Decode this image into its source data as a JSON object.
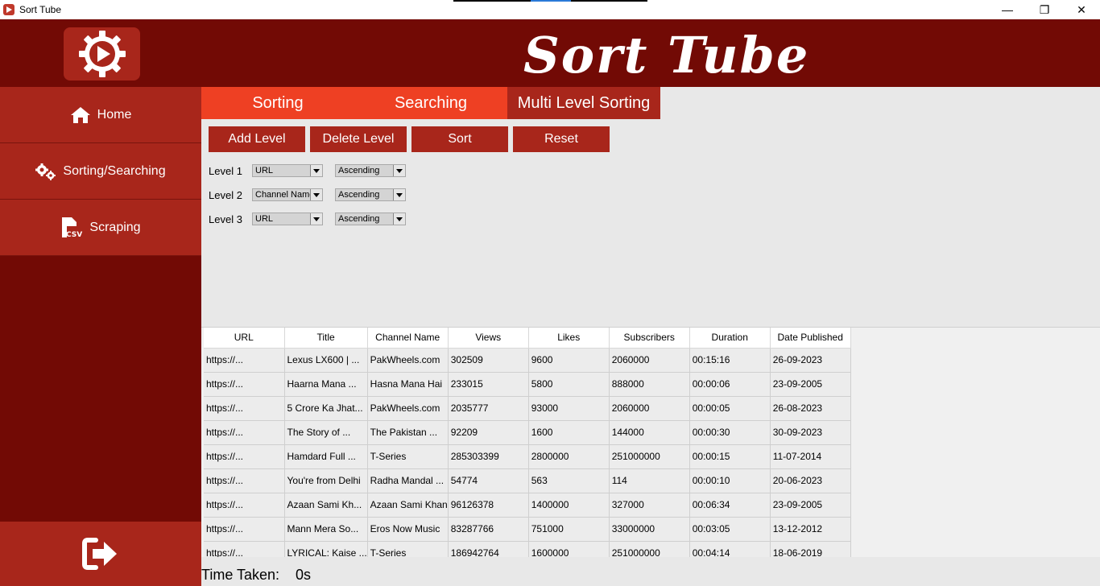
{
  "window": {
    "title": "Sort Tube",
    "min": "—",
    "max": "❐",
    "close": "✕"
  },
  "header": {
    "app_title": "Sort Tube"
  },
  "sidebar": {
    "items": [
      {
        "label": "Home",
        "icon": "home-icon"
      },
      {
        "label": "Sorting/Searching",
        "icon": "gears-icon"
      },
      {
        "label": "Scraping",
        "icon": "csv-file-icon"
      }
    ],
    "exit_icon": "logout-icon"
  },
  "tabs": [
    {
      "label": "Sorting"
    },
    {
      "label": "Searching"
    },
    {
      "label": "Multi Level Sorting",
      "active": true
    }
  ],
  "buttons": {
    "add_level": "Add Level",
    "delete_level": "Delete Level",
    "sort": "Sort",
    "reset": "Reset"
  },
  "levels": [
    {
      "label": "Level 1",
      "field": "URL",
      "order": "Ascending"
    },
    {
      "label": "Level 2",
      "field": "Channel Name",
      "order": "Ascending"
    },
    {
      "label": "Level 3",
      "field": "URL",
      "order": "Ascending"
    }
  ],
  "table": {
    "columns": [
      "URL",
      "Title",
      "Channel Name",
      "Views",
      "Likes",
      "Subscribers",
      "Duration",
      "Date Published"
    ],
    "rows": [
      [
        "https://...",
        "Lexus LX600 | ...",
        "PakWheels.com",
        "302509",
        "9600",
        "2060000",
        "00:15:16",
        "26-09-2023"
      ],
      [
        "https://...",
        "Haarna Mana ...",
        "Hasna Mana Hai",
        "233015",
        "5800",
        "888000",
        "00:00:06",
        "23-09-2005"
      ],
      [
        "https://...",
        "5 Crore Ka Jhat...",
        "PakWheels.com",
        "2035777",
        "93000",
        "2060000",
        "00:00:05",
        "26-08-2023"
      ],
      [
        "https://...",
        "The Story of ...",
        "The Pakistan ...",
        "92209",
        "1600",
        "144000",
        "00:00:30",
        "30-09-2023"
      ],
      [
        "https://...",
        "Hamdard Full ...",
        "T-Series",
        "285303399",
        "2800000",
        "251000000",
        "00:00:15",
        "11-07-2014"
      ],
      [
        "https://...",
        "You're from Delhi",
        "Radha Mandal ...",
        "54774",
        "563",
        "114",
        "00:00:10",
        "20-06-2023"
      ],
      [
        "https://...",
        "Azaan Sami Kh...",
        "Azaan Sami Khan",
        "96126378",
        "1400000",
        "327000",
        "00:06:34",
        "23-09-2005"
      ],
      [
        "https://...",
        "Mann Mera So...",
        "Eros Now Music",
        "83287766",
        "751000",
        "33000000",
        "00:03:05",
        "13-12-2012"
      ],
      [
        "https://...",
        "LYRICAL: Kaise ...",
        "T-Series",
        "186942764",
        "1600000",
        "251000000",
        "00:04:14",
        "18-06-2019"
      ]
    ]
  },
  "status": {
    "time_label": "Time Taken:",
    "time_value": "0s"
  }
}
